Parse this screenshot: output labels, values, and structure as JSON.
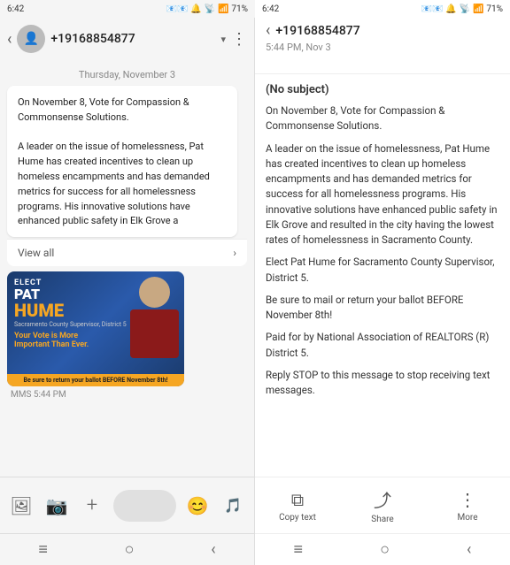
{
  "leftStatus": {
    "time": "6:42",
    "icons": "📧📧⬛🔔",
    "signal": "📶",
    "battery": "71%",
    "wifi": "📡"
  },
  "rightStatus": {
    "time": "6:42",
    "icons": "📧📧⬛🔔",
    "signal": "📶",
    "battery": "71%"
  },
  "left": {
    "backLabel": "‹",
    "contactName": "+19168854877",
    "dropdownArrow": "▾",
    "moreBtn": "⋮",
    "dateSeparator": "Thursday, November 3",
    "messageText": "On November 8, Vote for Compassion & Commonsense Solutions.\n\nA leader on the issue of homelessness, Pat Hume has created incentives to clean up homeless encampments and has demanded metrics for success for all homelessness programs. His innovative solutions have enhanced public safety in Elk Grove a",
    "viewAll": "View all",
    "mmsTimestamp": "MMS 5:44 PM",
    "imageElect": "ELECT",
    "imagePat": "PAT",
    "imageHume": "HUME",
    "imageSubtitle": "Sacramento County Supervisor, District 5",
    "imageVote": "Your Vote is More\nImportant Than Ever.",
    "imageBanner": "Be sure to return your ballot BEFORE November 8th!",
    "inputPlaceholder": "",
    "toolbarIcons": {
      "image": "🖼",
      "camera": "📷",
      "add": "+",
      "emoji": "😊",
      "audio": "🎵"
    }
  },
  "right": {
    "backLabel": "‹",
    "contactName": "+19168854877",
    "timestamp": "5:44 PM, Nov 3",
    "subject": "(No subject)",
    "bodyParagraphs": [
      "On November 8, Vote for Compassion & Commonsense Solutions.",
      "A leader on the issue of homelessness, Pat Hume has created incentives to clean up homeless encampments and has demanded metrics for success for all homelessness programs. His innovative solutions have enhanced public safety in Elk Grove and resulted in the city having the lowest rates of homelessness in Sacramento County.",
      "Elect Pat Hume for Sacramento County Supervisor, District 5.",
      "Be sure to mail or return your ballot BEFORE November 8th!",
      "Paid for by National Association of REALTORS (R) District 5.",
      "Reply STOP to this message to stop receiving text messages."
    ],
    "bottomActions": [
      {
        "icon": "⧉",
        "label": "Copy text"
      },
      {
        "icon": "⤴",
        "label": "Share"
      },
      {
        "icon": "⋮",
        "label": "More"
      }
    ]
  },
  "navBar": {
    "menu": "≡",
    "home": "○",
    "back": "‹"
  }
}
